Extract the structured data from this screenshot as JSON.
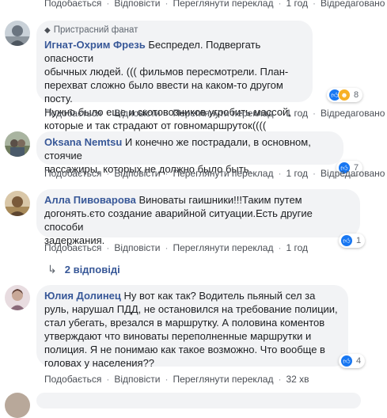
{
  "top_action_row": {
    "like": "Подобається",
    "reply": "Відповісти",
    "see_translation": "Переглянути переклад",
    "time": "1 год",
    "edited": "Відредаговано"
  },
  "comments": [
    {
      "badge": "Пристрасний фанат",
      "author": "Игнат-Охрим Фрезь",
      "text_lines": [
        "Беспредел. Подвергать опасности",
        "обычных людей. ((( фильмов пересмотрели. План-",
        "перехват сложно было ввести на каком-то другом посту.",
        "Нужно было еще и скотовозников угробить массой,",
        "которые и так страдают от говномаршруток(((("
      ],
      "reactions": [
        "like",
        "haha"
      ],
      "reaction_count": "8",
      "like": "Подобається",
      "reply": "Відповісти",
      "see_translation": "Переглянути переклад",
      "time": "1 год",
      "edited": "Відредаговано"
    },
    {
      "author": "Oksana Nemtsu",
      "text_lines": [
        "И конечно же пострадали, в основном, стоячие",
        "пассажиры, которых не должно было быть."
      ],
      "reactions": [
        "like"
      ],
      "reaction_count": "7",
      "like": "Подобається",
      "reply": "Відповісти",
      "see_translation": "Переглянути переклад",
      "time": "1 год",
      "edited": "Відредаговано"
    },
    {
      "author": "Алла Пивоварова",
      "text_lines": [
        "Виноваты гаишники!!!Таким путем",
        "догонять.єто создание аварийной ситуации.Есть другие способи",
        "задержания."
      ],
      "reactions": [
        "like"
      ],
      "reaction_count": "1",
      "like": "Подобається",
      "reply": "Відповісти",
      "see_translation": "Переглянути переклад",
      "time": "1 год",
      "replies_label": "2 відповіді"
    },
    {
      "author": "Юлия Долинец",
      "text_lines": [
        "Ну вот как так? Водитель пьяный сел за",
        "руль, нарушал ПДД, не остановился на требование полиции,",
        "стал убегать, врезался в маршрутку. А половина коментов",
        "утверждают что виноваты переполненные маршрутки и",
        "полиция. Я не понимаю как такое возможно. Что вообще в",
        "головах у населения??"
      ],
      "reactions": [
        "like"
      ],
      "reaction_count": "4",
      "like": "Подобається",
      "reply": "Відповісти",
      "see_translation": "Переглянути переклад",
      "time": "32 хв"
    }
  ],
  "colors": {
    "link": "#385898",
    "bubble": "#f2f3f5",
    "meta": "#4b4f56",
    "like": "#1877f2",
    "haha": "#f7b125"
  }
}
